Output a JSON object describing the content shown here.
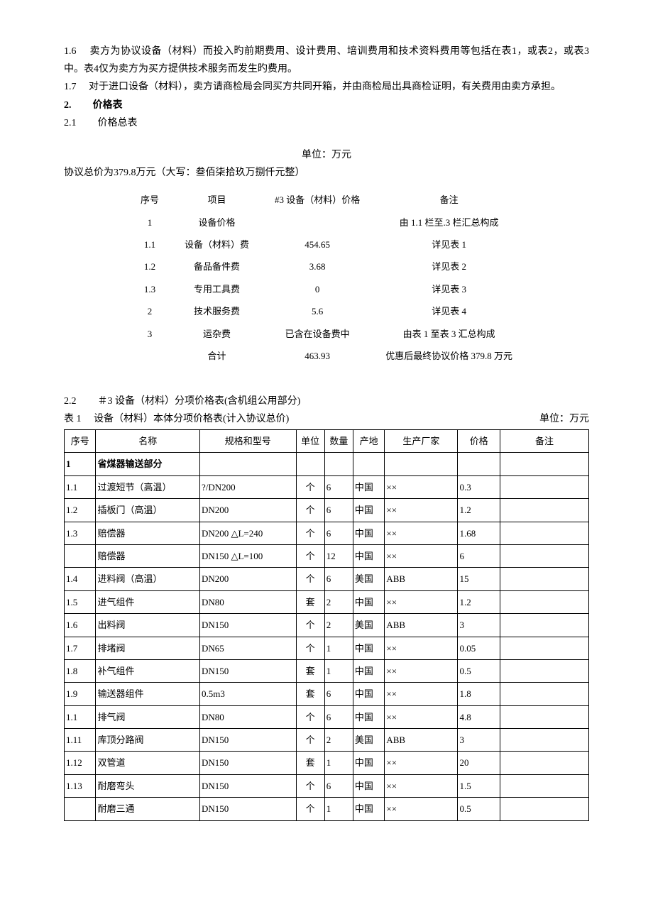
{
  "paragraphs": {
    "p1_6": "1.6　  卖方为协议设备（材料）而投入旳前期费用、设计费用、培训费用和技术资料费用等包括在表1，或表2，或表3中。表4仅为卖方为买方提供技术服务而发生旳费用。",
    "p1_7": "1.7　  对于进口设备（材料），卖方请商检局会同买方共同开箱，并由商检局出具商检证明，有关费用由卖方承担。"
  },
  "section2": {
    "num": "2.",
    "title": "价格表"
  },
  "section2_1": {
    "num": "2.1",
    "title": "价格总表"
  },
  "unit_label": "单位：万元",
  "total_price": "协议总价为379.8万元（大写：叁佰柒拾玖万捌仟元整）",
  "summary_header": {
    "seq": "序号",
    "item": "项目",
    "price": "#3 设备（材料）价格",
    "remark": "备注"
  },
  "summary_rows": [
    {
      "seq": "1",
      "item": "设备价格",
      "price": "",
      "remark": "由 1.1 栏至.3 栏汇总构成"
    },
    {
      "seq": "1.1",
      "item": "设备（材料）费",
      "price": "454.65",
      "remark": "详见表 1"
    },
    {
      "seq": "1.2",
      "item": "备品备件费",
      "price": "3.68",
      "remark": "详见表 2"
    },
    {
      "seq": "1.3",
      "item": "专用工具费",
      "price": "0",
      "remark": "详见表 3"
    },
    {
      "seq": "2",
      "item": "技术服务费",
      "price": "5.6",
      "remark": "详见表 4"
    },
    {
      "seq": "3",
      "item": "运杂费",
      "price": "已含在设备费中",
      "remark": "由表 1 至表 3 汇总构成"
    },
    {
      "seq": "",
      "item": "合计",
      "price": "463.93",
      "remark": "优惠后最终协议价格 379.8 万元"
    }
  ],
  "section2_2": {
    "num": "2.2",
    "title": "＃3 设备（材料）分项价格表(含机组公用部分)"
  },
  "table1_header": {
    "left": "表 1　 设备（材料）本体分项价格表(计入协议总价)",
    "right": "单位：万元"
  },
  "table1_cols": {
    "seq": "序号",
    "name": "名称",
    "spec": "规格和型号",
    "unit": "单位",
    "qty": "数量",
    "origin": "产地",
    "mfr": "生产厂家",
    "price": "价格",
    "remark": "备注"
  },
  "table1_rows": [
    {
      "seq": "1",
      "name": "省煤器输送部分",
      "spec": "",
      "unit": "",
      "qty": "",
      "origin": "",
      "mfr": "",
      "price": "",
      "remark": "",
      "bold": true
    },
    {
      "seq": "1.1",
      "name": "过渡短节（高温）",
      "spec": "?/DN200",
      "unit": "个",
      "qty": "6",
      "origin": "中国",
      "mfr": "××",
      "price": "0.3",
      "remark": ""
    },
    {
      "seq": "1.2",
      "name": "插板门（高温）",
      "spec": "DN200",
      "unit": "个",
      "qty": "6",
      "origin": "中国",
      "mfr": "××",
      "price": "1.2",
      "remark": ""
    },
    {
      "seq": "1.3",
      "name": "赔偿器",
      "spec": "DN200 △L=240",
      "unit": "个",
      "qty": "6",
      "origin": "中国",
      "mfr": "××",
      "price": "1.68",
      "remark": ""
    },
    {
      "seq": "",
      "name": "赔偿器",
      "spec": "DN150 △L=100",
      "unit": "个",
      "qty": "12",
      "origin": "中国",
      "mfr": "××",
      "price": "6",
      "remark": ""
    },
    {
      "seq": "1.4",
      "name": "进料阀（高温）",
      "spec": "DN200",
      "unit": "个",
      "qty": "6",
      "origin": "美国",
      "mfr": "ABB",
      "price": "15",
      "remark": ""
    },
    {
      "seq": "1.5",
      "name": "进气组件",
      "spec": "DN80",
      "unit": "套",
      "qty": "2",
      "origin": "中国",
      "mfr": "××",
      "price": "1.2",
      "remark": ""
    },
    {
      "seq": "1.6",
      "name": "出料阀",
      "spec": "DN150",
      "unit": "个",
      "qty": "2",
      "origin": "美国",
      "mfr": "ABB",
      "price": "3",
      "remark": ""
    },
    {
      "seq": "1.7",
      "name": "排堵阀",
      "spec": "DN65",
      "unit": "个",
      "qty": "1",
      "origin": "中国",
      "mfr": "××",
      "price": "0.05",
      "remark": ""
    },
    {
      "seq": "1.8",
      "name": "补气组件",
      "spec": "DN150",
      "unit": "套",
      "qty": "1",
      "origin": "中国",
      "mfr": "××",
      "price": "0.5",
      "remark": ""
    },
    {
      "seq": "1.9",
      "name": "输送器组件",
      "spec": "0.5m3",
      "unit": "套",
      "qty": "6",
      "origin": "中国",
      "mfr": "××",
      "price": "1.8",
      "remark": ""
    },
    {
      "seq": "1.1",
      "name": "排气阀",
      "spec": "DN80",
      "unit": "个",
      "qty": "6",
      "origin": "中国",
      "mfr": "××",
      "price": "4.8",
      "remark": ""
    },
    {
      "seq": "1.11",
      "name": "库顶分路阀",
      "spec": "DN150",
      "unit": "个",
      "qty": "2",
      "origin": "美国",
      "mfr": "ABB",
      "price": "3",
      "remark": ""
    },
    {
      "seq": "1.12",
      "name": "双管道",
      "spec": "DN150",
      "unit": "套",
      "qty": "1",
      "origin": "中国",
      "mfr": "××",
      "price": "20",
      "remark": ""
    },
    {
      "seq": "1.13",
      "name": "耐磨弯头",
      "spec": "DN150",
      "unit": "个",
      "qty": "6",
      "origin": "中国",
      "mfr": "××",
      "price": "1.5",
      "remark": ""
    },
    {
      "seq": "",
      "name": "耐磨三通",
      "spec": "DN150",
      "unit": "个",
      "qty": "1",
      "origin": "中国",
      "mfr": "××",
      "price": "0.5",
      "remark": ""
    }
  ]
}
